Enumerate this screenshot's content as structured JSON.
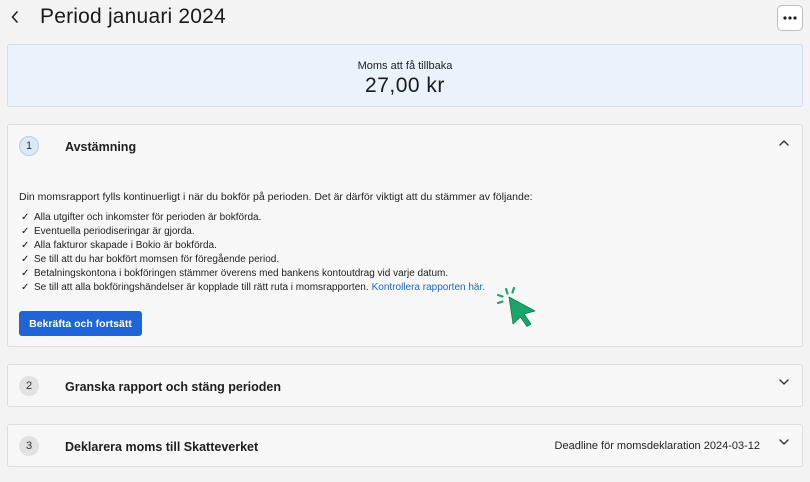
{
  "header": {
    "title": "Period januari 2024",
    "back_icon": "chevron-left-icon",
    "more_icon": "ellipsis-icon"
  },
  "summary": {
    "label": "Moms att få tillbaka",
    "amount": "27,00 kr"
  },
  "steps": [
    {
      "number": "1",
      "title": "Avstämning",
      "expanded": true,
      "intro": "Din momsrapport fylls kontinuerligt i när du bokför på perioden. Det är därför viktigt att du stämmer av följande:",
      "checklist": [
        "Alla utgifter och inkomster för perioden är bokförda.",
        "Eventuella periodiseringar är gjorda.",
        "Alla fakturor skapade i Bokio är bokförda.",
        "Se till att du har bokfört momsen för föregående period.",
        "Betalningskontona i bokföringen stämmer överens med bankens kontoutdrag vid varje datum.",
        "Se till att alla bokföringshändelser är kopplade till rätt ruta i momsrapporten."
      ],
      "check_glyph": "✓",
      "link_label": "Kontrollera rapporten här.",
      "button_label": "Bekräfta och fortsätt"
    },
    {
      "number": "2",
      "title": "Granska rapport och stäng perioden",
      "expanded": false
    },
    {
      "number": "3",
      "title": "Deklarera moms till Skatteverket",
      "expanded": false,
      "deadline": "Deadline för momsdeklaration 2024-03-12"
    }
  ],
  "colors": {
    "primary": "#1f64d9",
    "link": "#2466c7",
    "summary_bg": "#eaf2fb",
    "cursor": "#1aa56b"
  }
}
